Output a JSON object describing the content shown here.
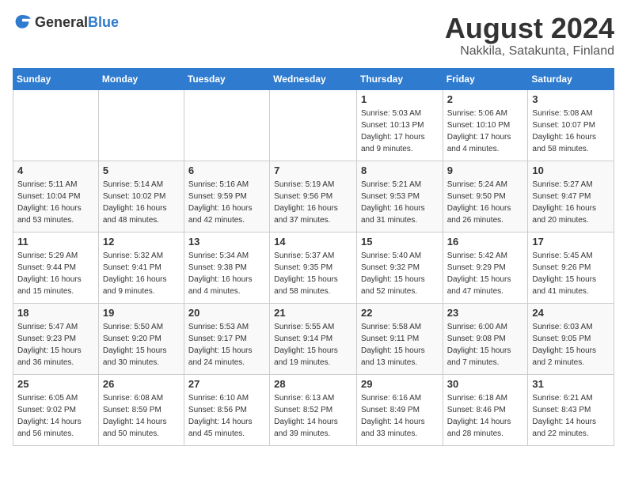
{
  "header": {
    "logo_general": "General",
    "logo_blue": "Blue",
    "title": "August 2024",
    "subtitle": "Nakkila, Satakunta, Finland"
  },
  "weekdays": [
    "Sunday",
    "Monday",
    "Tuesday",
    "Wednesday",
    "Thursday",
    "Friday",
    "Saturday"
  ],
  "weeks": [
    [
      {
        "day": "",
        "info": ""
      },
      {
        "day": "",
        "info": ""
      },
      {
        "day": "",
        "info": ""
      },
      {
        "day": "",
        "info": ""
      },
      {
        "day": "1",
        "info": "Sunrise: 5:03 AM\nSunset: 10:13 PM\nDaylight: 17 hours\nand 9 minutes."
      },
      {
        "day": "2",
        "info": "Sunrise: 5:06 AM\nSunset: 10:10 PM\nDaylight: 17 hours\nand 4 minutes."
      },
      {
        "day": "3",
        "info": "Sunrise: 5:08 AM\nSunset: 10:07 PM\nDaylight: 16 hours\nand 58 minutes."
      }
    ],
    [
      {
        "day": "4",
        "info": "Sunrise: 5:11 AM\nSunset: 10:04 PM\nDaylight: 16 hours\nand 53 minutes."
      },
      {
        "day": "5",
        "info": "Sunrise: 5:14 AM\nSunset: 10:02 PM\nDaylight: 16 hours\nand 48 minutes."
      },
      {
        "day": "6",
        "info": "Sunrise: 5:16 AM\nSunset: 9:59 PM\nDaylight: 16 hours\nand 42 minutes."
      },
      {
        "day": "7",
        "info": "Sunrise: 5:19 AM\nSunset: 9:56 PM\nDaylight: 16 hours\nand 37 minutes."
      },
      {
        "day": "8",
        "info": "Sunrise: 5:21 AM\nSunset: 9:53 PM\nDaylight: 16 hours\nand 31 minutes."
      },
      {
        "day": "9",
        "info": "Sunrise: 5:24 AM\nSunset: 9:50 PM\nDaylight: 16 hours\nand 26 minutes."
      },
      {
        "day": "10",
        "info": "Sunrise: 5:27 AM\nSunset: 9:47 PM\nDaylight: 16 hours\nand 20 minutes."
      }
    ],
    [
      {
        "day": "11",
        "info": "Sunrise: 5:29 AM\nSunset: 9:44 PM\nDaylight: 16 hours\nand 15 minutes."
      },
      {
        "day": "12",
        "info": "Sunrise: 5:32 AM\nSunset: 9:41 PM\nDaylight: 16 hours\nand 9 minutes."
      },
      {
        "day": "13",
        "info": "Sunrise: 5:34 AM\nSunset: 9:38 PM\nDaylight: 16 hours\nand 4 minutes."
      },
      {
        "day": "14",
        "info": "Sunrise: 5:37 AM\nSunset: 9:35 PM\nDaylight: 15 hours\nand 58 minutes."
      },
      {
        "day": "15",
        "info": "Sunrise: 5:40 AM\nSunset: 9:32 PM\nDaylight: 15 hours\nand 52 minutes."
      },
      {
        "day": "16",
        "info": "Sunrise: 5:42 AM\nSunset: 9:29 PM\nDaylight: 15 hours\nand 47 minutes."
      },
      {
        "day": "17",
        "info": "Sunrise: 5:45 AM\nSunset: 9:26 PM\nDaylight: 15 hours\nand 41 minutes."
      }
    ],
    [
      {
        "day": "18",
        "info": "Sunrise: 5:47 AM\nSunset: 9:23 PM\nDaylight: 15 hours\nand 36 minutes."
      },
      {
        "day": "19",
        "info": "Sunrise: 5:50 AM\nSunset: 9:20 PM\nDaylight: 15 hours\nand 30 minutes."
      },
      {
        "day": "20",
        "info": "Sunrise: 5:53 AM\nSunset: 9:17 PM\nDaylight: 15 hours\nand 24 minutes."
      },
      {
        "day": "21",
        "info": "Sunrise: 5:55 AM\nSunset: 9:14 PM\nDaylight: 15 hours\nand 19 minutes."
      },
      {
        "day": "22",
        "info": "Sunrise: 5:58 AM\nSunset: 9:11 PM\nDaylight: 15 hours\nand 13 minutes."
      },
      {
        "day": "23",
        "info": "Sunrise: 6:00 AM\nSunset: 9:08 PM\nDaylight: 15 hours\nand 7 minutes."
      },
      {
        "day": "24",
        "info": "Sunrise: 6:03 AM\nSunset: 9:05 PM\nDaylight: 15 hours\nand 2 minutes."
      }
    ],
    [
      {
        "day": "25",
        "info": "Sunrise: 6:05 AM\nSunset: 9:02 PM\nDaylight: 14 hours\nand 56 minutes."
      },
      {
        "day": "26",
        "info": "Sunrise: 6:08 AM\nSunset: 8:59 PM\nDaylight: 14 hours\nand 50 minutes."
      },
      {
        "day": "27",
        "info": "Sunrise: 6:10 AM\nSunset: 8:56 PM\nDaylight: 14 hours\nand 45 minutes."
      },
      {
        "day": "28",
        "info": "Sunrise: 6:13 AM\nSunset: 8:52 PM\nDaylight: 14 hours\nand 39 minutes."
      },
      {
        "day": "29",
        "info": "Sunrise: 6:16 AM\nSunset: 8:49 PM\nDaylight: 14 hours\nand 33 minutes."
      },
      {
        "day": "30",
        "info": "Sunrise: 6:18 AM\nSunset: 8:46 PM\nDaylight: 14 hours\nand 28 minutes."
      },
      {
        "day": "31",
        "info": "Sunrise: 6:21 AM\nSunset: 8:43 PM\nDaylight: 14 hours\nand 22 minutes."
      }
    ]
  ]
}
